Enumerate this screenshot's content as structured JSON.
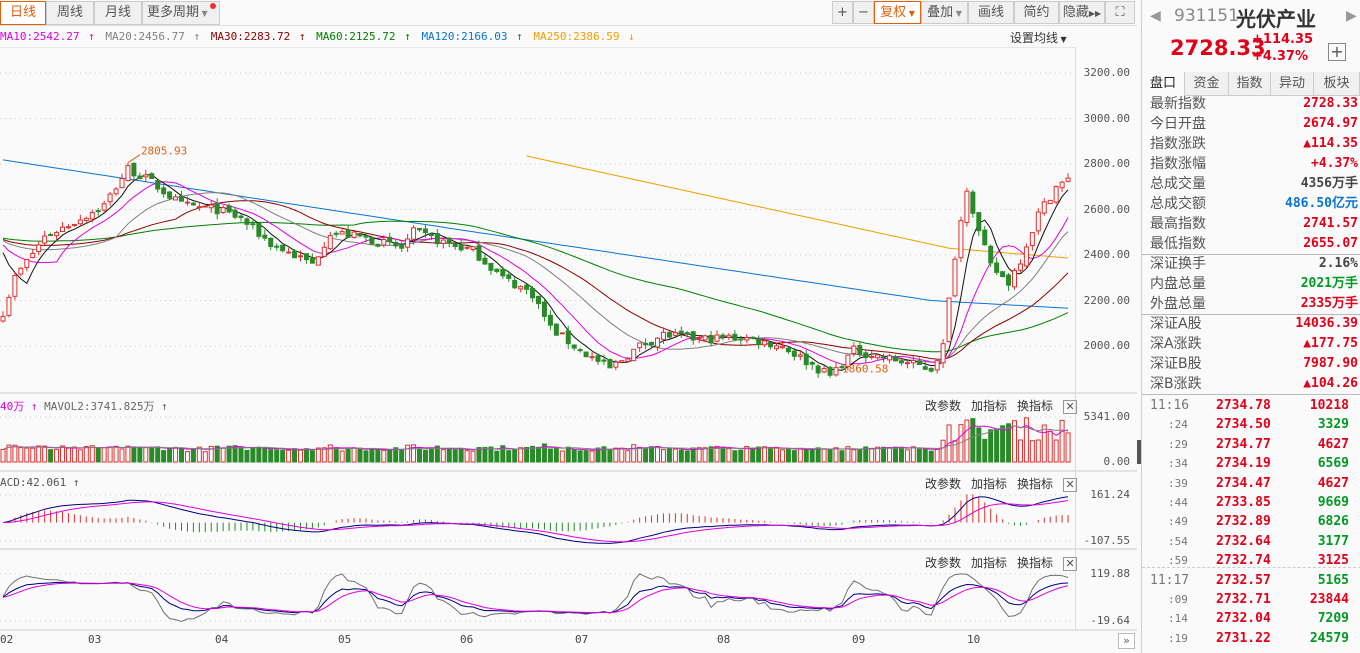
{
  "period_tabs": [
    "日线",
    "周线",
    "月线",
    "更多周期"
  ],
  "toolbar": {
    "zoom_in": "+",
    "zoom_out": "−",
    "fuquan": "复权",
    "overlay": "叠加",
    "draw": "画线",
    "simple": "简约",
    "hide": "隐藏",
    "fullscreen": "⛶"
  },
  "ma_legend": [
    {
      "label": "MA10:2542.27",
      "arrow": "↑",
      "color": "#e000e0"
    },
    {
      "label": "MA20:2456.77",
      "arrow": "↑",
      "color": "#808080"
    },
    {
      "label": "MA30:2283.72",
      "arrow": "↑",
      "color": "#8b0000"
    },
    {
      "label": "MA60:2125.72",
      "arrow": "↑",
      "color": "#008000"
    },
    {
      "label": "MA120:2166.03",
      "arrow": "↑",
      "color": "#0a74d0"
    },
    {
      "label": "MA250:2386.59",
      "arrow": "↓",
      "color": "#f0a000"
    }
  ],
  "set_ma": "设置均线",
  "price_axis": [
    "3200.00",
    "3000.00",
    "2800.00",
    "2600.00",
    "2400.00",
    "2200.00",
    "2000.00"
  ],
  "price_ticks": [
    3200,
    3000,
    2800,
    2600,
    2400,
    2200,
    2000
  ],
  "annotations": {
    "high": "2805.93",
    "low": "1860.58"
  },
  "volume_panel": {
    "legend_a": "40万",
    "legend_b": "MAVOL2:3741.825万",
    "axis": [
      "5341.00",
      "0.00"
    ]
  },
  "macd_panel": {
    "legend": "ACD:42.061",
    "axis": [
      "161.24",
      "-107.55"
    ]
  },
  "kdj_panel": {
    "axis": [
      "119.88",
      "-19.64"
    ]
  },
  "panel_actions": [
    "改参数",
    "加指标",
    "换指标"
  ],
  "x_labels": [
    "02",
    "03",
    "04",
    "05",
    "06",
    "07",
    "08",
    "09",
    "10"
  ],
  "colors": {
    "up": "#e03030",
    "down": "#2a8a2a",
    "ma5": "#101010",
    "ma10": "#e000e0",
    "ma20": "#808080",
    "ma30": "#8b0000",
    "ma60": "#008000",
    "ma120": "#0a74d0",
    "ma250": "#f0a000",
    "accent": "#e06010"
  },
  "chart_data": {
    "type": "candlestick",
    "price_keypoints": [
      [
        0,
        2150
      ],
      [
        2,
        2300
      ],
      [
        7,
        2480
      ],
      [
        13,
        2560
      ],
      [
        17,
        2620
      ],
      [
        21,
        2780
      ],
      [
        25,
        2720
      ],
      [
        30,
        2620
      ],
      [
        36,
        2600
      ],
      [
        40,
        2560
      ],
      [
        45,
        2450
      ],
      [
        52,
        2360
      ],
      [
        55,
        2500
      ],
      [
        60,
        2480
      ],
      [
        67,
        2430
      ],
      [
        69,
        2500
      ],
      [
        76,
        2440
      ],
      [
        79,
        2420
      ],
      [
        84,
        2300
      ],
      [
        89,
        2230
      ],
      [
        92,
        2080
      ],
      [
        97,
        1980
      ],
      [
        102,
        1900
      ],
      [
        107,
        2000
      ],
      [
        111,
        2050
      ],
      [
        117,
        2030
      ],
      [
        124,
        2040
      ],
      [
        131,
        2000
      ],
      [
        137,
        1900
      ],
      [
        139,
        1870
      ],
      [
        143,
        1980
      ],
      [
        148,
        1950
      ],
      [
        156,
        1900
      ],
      [
        158,
        2000
      ],
      [
        160,
        2400
      ],
      [
        162,
        2700
      ],
      [
        164,
        2500
      ],
      [
        166,
        2350
      ],
      [
        169,
        2280
      ],
      [
        171,
        2380
      ],
      [
        174,
        2580
      ],
      [
        177,
        2700
      ],
      [
        179,
        2728
      ]
    ],
    "ma120_keypoints": [
      [
        0,
        2818
      ],
      [
        77,
        2510
      ],
      [
        156,
        2200
      ],
      [
        179,
        2166
      ]
    ],
    "ma250_keypoints": [
      [
        88,
        2835
      ],
      [
        159,
        2430
      ],
      [
        179,
        2387
      ]
    ],
    "candles": 180,
    "ylim": [
      1860,
      3300
    ]
  },
  "right_panel": {
    "code": "931151",
    "name": "光伏产业",
    "price": "2728.33",
    "change": "+114.35",
    "change_pct": "+4.37%",
    "tabs": [
      "盘口",
      "资金",
      "指数",
      "异动",
      "板块"
    ],
    "stats": [
      {
        "label": "最新指数",
        "value": "2728.33",
        "cls": "red"
      },
      {
        "label": "今日开盘",
        "value": "2674.97",
        "cls": "red"
      },
      {
        "label": "指数涨跌",
        "value": "▲114.35",
        "cls": "red"
      },
      {
        "label": "指数涨幅",
        "value": "+4.37%",
        "cls": "red"
      },
      {
        "label": "总成交量",
        "value": "4356万手",
        "cls": "gray"
      },
      {
        "label": "总成交额",
        "value": "486.50亿元",
        "cls": "blue"
      },
      {
        "label": "最高指数",
        "value": "2741.57",
        "cls": "red"
      },
      {
        "label": "最低指数",
        "value": "2655.07",
        "cls": "red"
      },
      {
        "label": "深证换手",
        "value": "2.16%",
        "cls": "gray"
      },
      {
        "label": "内盘总量",
        "value": "2021万手",
        "cls": "green"
      },
      {
        "label": "外盘总量",
        "value": "2335万手",
        "cls": "red"
      },
      {
        "label": "深证A股",
        "value": "14036.39",
        "cls": "red"
      },
      {
        "label": "深A涨跌",
        "value": "▲177.75",
        "cls": "red"
      },
      {
        "label": "深证B股",
        "value": "7987.90",
        "cls": "red"
      },
      {
        "label": "深B涨跌",
        "value": "▲104.26",
        "cls": "red"
      }
    ],
    "ticks": [
      {
        "time": "11:16",
        "price": "2734.78",
        "vol": "10218",
        "cls": "red"
      },
      {
        "time": ":24",
        "price": "2734.50",
        "vol": "3329",
        "cls": "green"
      },
      {
        "time": ":29",
        "price": "2734.77",
        "vol": "4627",
        "cls": "red"
      },
      {
        "time": ":34",
        "price": "2734.19",
        "vol": "6569",
        "cls": "green"
      },
      {
        "time": ":39",
        "price": "2734.47",
        "vol": "4627",
        "cls": "red"
      },
      {
        "time": ":44",
        "price": "2733.85",
        "vol": "9669",
        "cls": "green"
      },
      {
        "time": ":49",
        "price": "2732.89",
        "vol": "6826",
        "cls": "green"
      },
      {
        "time": ":54",
        "price": "2732.64",
        "vol": "3177",
        "cls": "green"
      },
      {
        "time": ":59",
        "price": "2732.74",
        "vol": "3125",
        "cls": "red"
      },
      {
        "time": "11:17",
        "price": "2732.57",
        "vol": "5165",
        "cls": "green"
      },
      {
        "time": ":09",
        "price": "2732.71",
        "vol": "23844",
        "cls": "red"
      },
      {
        "time": ":14",
        "price": "2732.04",
        "vol": "7209",
        "cls": "green"
      },
      {
        "time": ":19",
        "price": "2731.22",
        "vol": "24579",
        "cls": "green"
      }
    ]
  }
}
